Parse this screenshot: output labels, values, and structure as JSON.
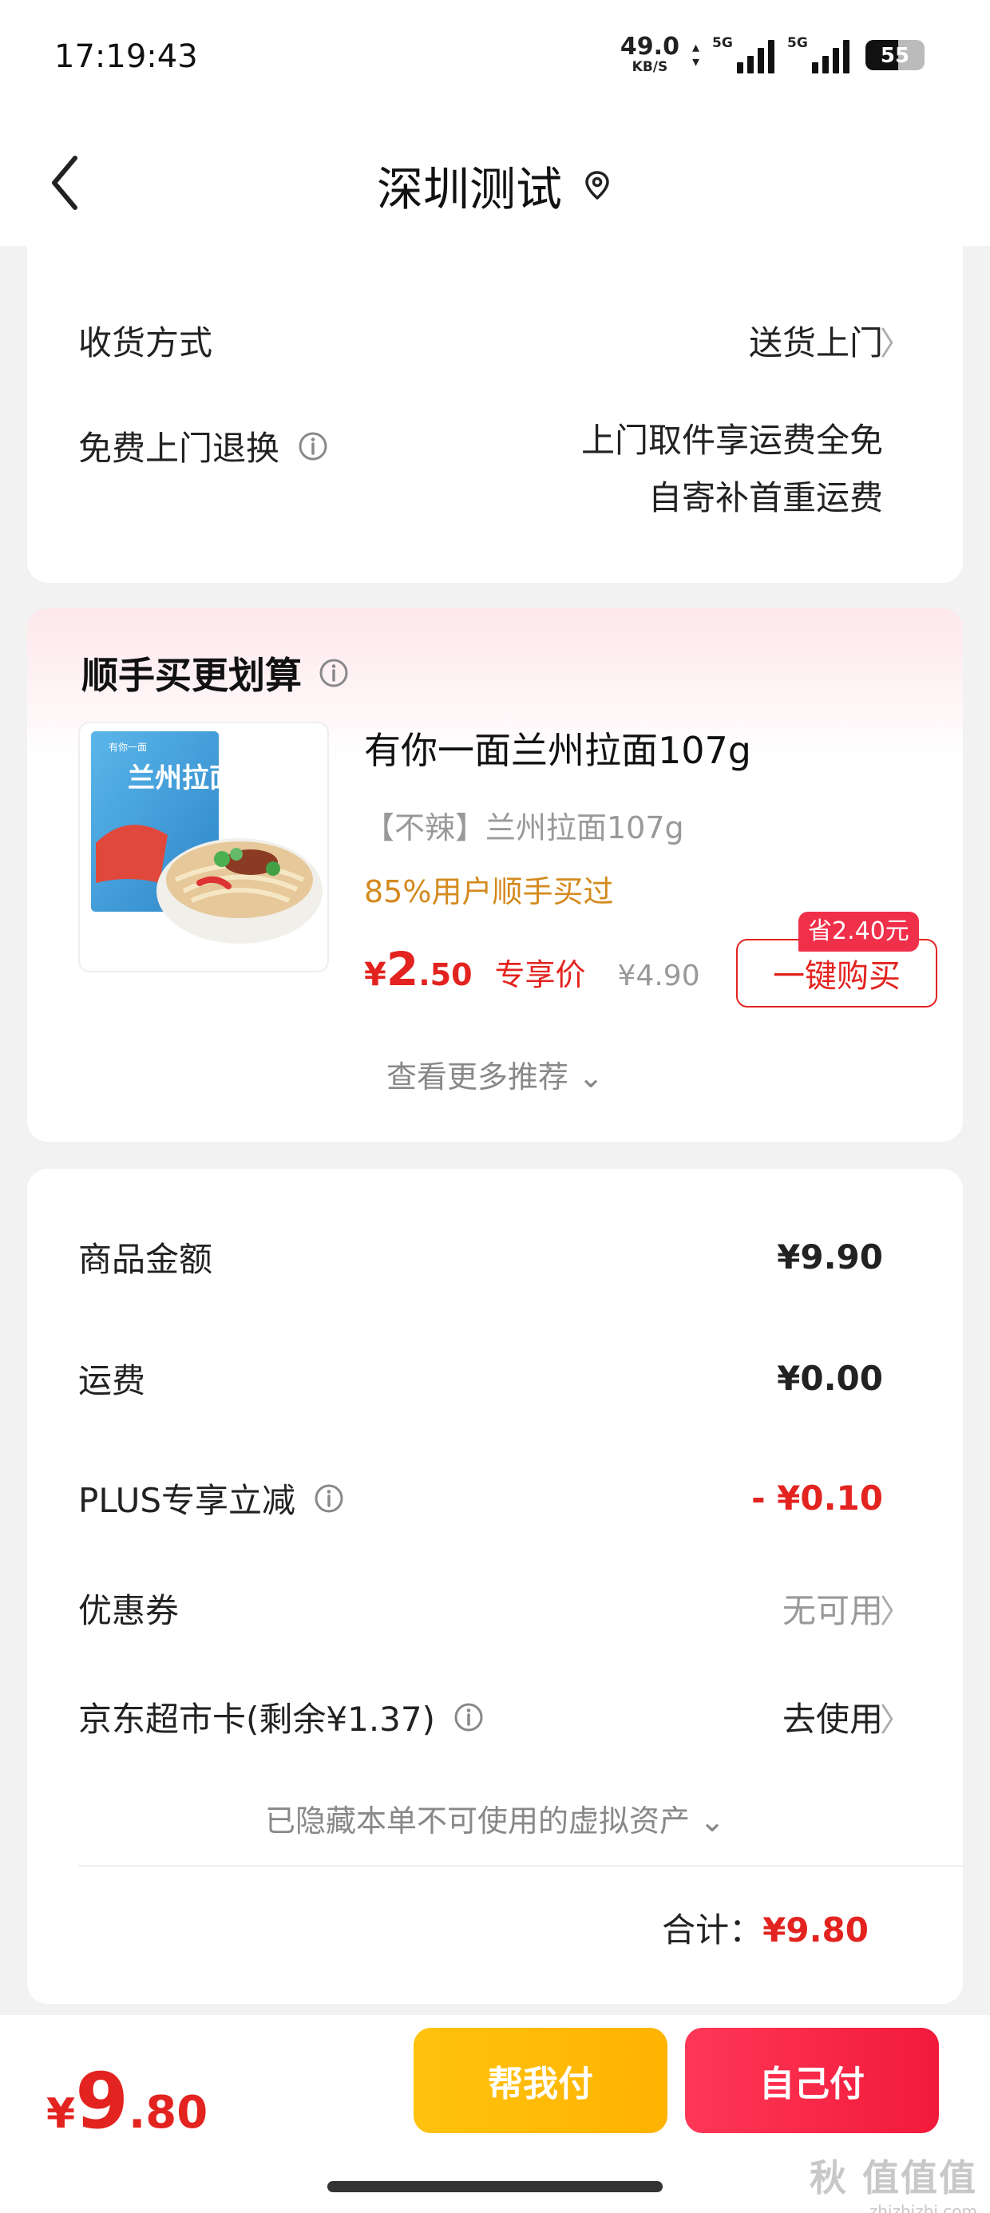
{
  "status_bar": {
    "time": "17:19:43",
    "net_speed": "49.0",
    "net_unit": "KB/S",
    "signal1_label": "5G",
    "signal2_label": "5G",
    "battery": "55"
  },
  "nav": {
    "title": "深圳测试",
    "back_icon": "chevron-left-icon",
    "location_icon": "location-pin-icon"
  },
  "delivery": {
    "method_label": "收货方式",
    "method_value": "送货上门",
    "return_label": "免费上门退换",
    "return_value_line1": "上门取件享运费全免",
    "return_value_line2": "自寄补首重运费"
  },
  "recommend": {
    "title": "顺手买更划算",
    "product": {
      "name": "有你一面兰州拉面107g",
      "spec": "【不辣】兰州拉面107g",
      "bought": "85%用户顺手买过",
      "price_yen": "¥",
      "price_int": "2",
      "price_dec": ".50",
      "price_label": "专享价",
      "original_price": "¥4.90",
      "save_badge": "省2.40元",
      "buy_button": "一键购买",
      "package_text": "兰州拉面",
      "package_brand": "有你一面"
    },
    "more": "查看更多推荐 ⌄"
  },
  "summary": {
    "goods_label": "商品金额",
    "goods_value": "¥9.90",
    "shipping_label": "运费",
    "shipping_value": "¥0.00",
    "plus_label": "PLUS专享立减",
    "plus_value": "- ¥0.10",
    "coupon_label": "优惠券",
    "coupon_value": "无可用",
    "card_label": "京东超市卡(剩余¥1.37)",
    "card_value": "去使用",
    "hidden_assets": "已隐藏本单不可使用的虚拟资产 ⌄",
    "total_label": "合计：",
    "total_value": "¥9.80"
  },
  "bottom": {
    "price_yen": "¥",
    "price_int": "9",
    "price_dec": ".80",
    "help_pay": "帮我付",
    "self_pay": "自己付"
  },
  "watermark": {
    "big": "秋 值值值",
    "small": "zhizhizhi.com"
  },
  "colors": {
    "accent_red": "#e3231f",
    "gold": "#d48a1e",
    "help_pay_yellow": "#ffc20e",
    "self_pay_red": "#f21a3a"
  }
}
